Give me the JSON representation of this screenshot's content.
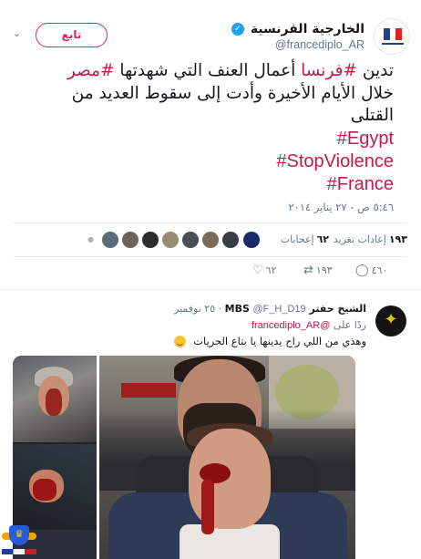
{
  "tweet": {
    "display_name": "الخارجية الفرنسية",
    "handle": "@francediplo_AR",
    "follow_label": "تابع",
    "text_line1_prefix": "تدين ",
    "text_hash1": "#فرنسا",
    "text_line1_mid": " أعمال العنف التي شهدتها ",
    "text_hash2": "#مصر",
    "text_line2": "خلال الأيام الأخيرة وأدت إلى سقوط العديد من",
    "text_line3": "القتلى",
    "hashtags": [
      "#Egypt",
      "#StopViolence",
      "#France"
    ],
    "timestamp": "٥:٤٦ ص - ٢٧ يناير ٢٠١٤",
    "retweets_count": "١٩٣",
    "retweets_label": "إعادات تغريد",
    "likes_count": "٦٢",
    "likes_label": "إعجابات",
    "action_reply_count": "٤٦٠",
    "action_retweet_count": "١٩٣",
    "action_like_count": "٦٢"
  },
  "reply": {
    "name": "الشيخ حفتر MBS",
    "handle": "@F_H_D19",
    "time": "٢٥ نوفمبر",
    "replying_prefix": "ردًا على",
    "mention": "@francediplo_AR",
    "text": "وهذي من اللي راح يدينها يا بتاع الحريات"
  },
  "colors": {
    "accent": "#c9184a",
    "follow_border": "#e0245e",
    "muted": "#657786",
    "verified": "#1da1f2"
  },
  "icons": {
    "verified": "verified-badge-icon",
    "caret": "chevron-down-icon",
    "reply": "reply-icon",
    "retweet": "retweet-icon",
    "like": "heart-icon"
  }
}
